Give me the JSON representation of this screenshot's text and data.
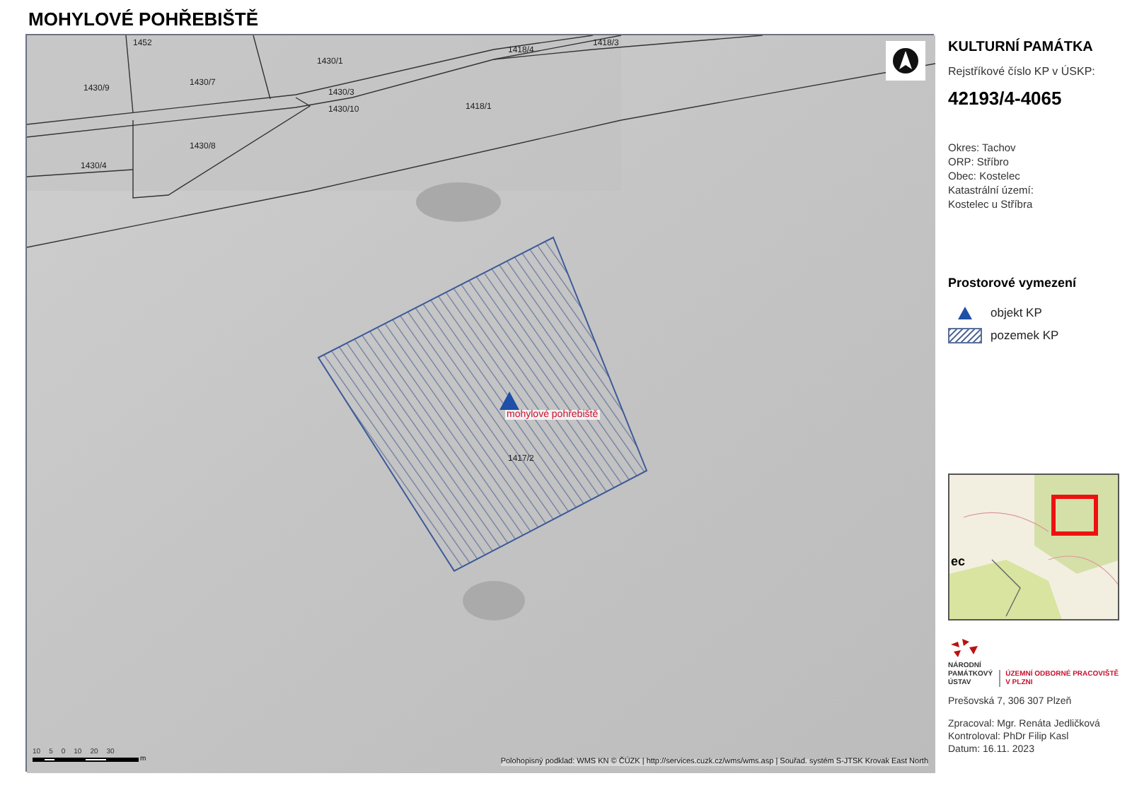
{
  "title": "MOHYLOVÉ POHŘEBIŠTĚ",
  "map": {
    "parcels": [
      "1452",
      "1430/9",
      "1430/7",
      "1430/1",
      "1418/4",
      "1418/3",
      "1430/3",
      "1430/10",
      "1418/1",
      "1430/8",
      "1430/4",
      "1417/2"
    ],
    "object_label": "mohylové pohřebiště",
    "scale_bar": {
      "ticks": [
        "10",
        "5",
        "0",
        "10",
        "20",
        "30"
      ],
      "unit": "m"
    },
    "attribution": "Polohopisný podklad: WMS KN © ČÚZK | http://services.cuzk.cz/wms/wms.asp  |  Souřad. systém S-JTSK Krovak East North"
  },
  "panel": {
    "heading": "KULTURNÍ PAMÁTKA",
    "register_label": "Rejstříkové číslo KP v ÚSKP:",
    "register_number": "42193/4-4065",
    "location": [
      "Okres: Tachov",
      "ORP: Stříbro",
      "Obec: Kostelec",
      "Katastrální území:",
      "Kostelec u Stříbra"
    ],
    "legend_title": "Prostorové vymezení",
    "legend": [
      {
        "kind": "triangle",
        "label": "objekt KP"
      },
      {
        "kind": "hatch",
        "label": "pozemek KP"
      }
    ],
    "locator_map": {
      "place_label": "ec"
    },
    "logo": {
      "name": [
        "NÁRODNÍ",
        "PAMÁTKOVÝ",
        "ÚSTAV"
      ],
      "unit": [
        "ÚZEMNÍ ODBORNÉ PRACOVIŠTĚ",
        "V PLZNI"
      ]
    },
    "address": "Prešovská 7, 306 307 Plzeň",
    "credits": [
      "Zpracoval: Mgr. Renáta Jedličková",
      "Kontroloval: PhDr Filip Kasl",
      "Datum: 16.11. 2023"
    ]
  }
}
